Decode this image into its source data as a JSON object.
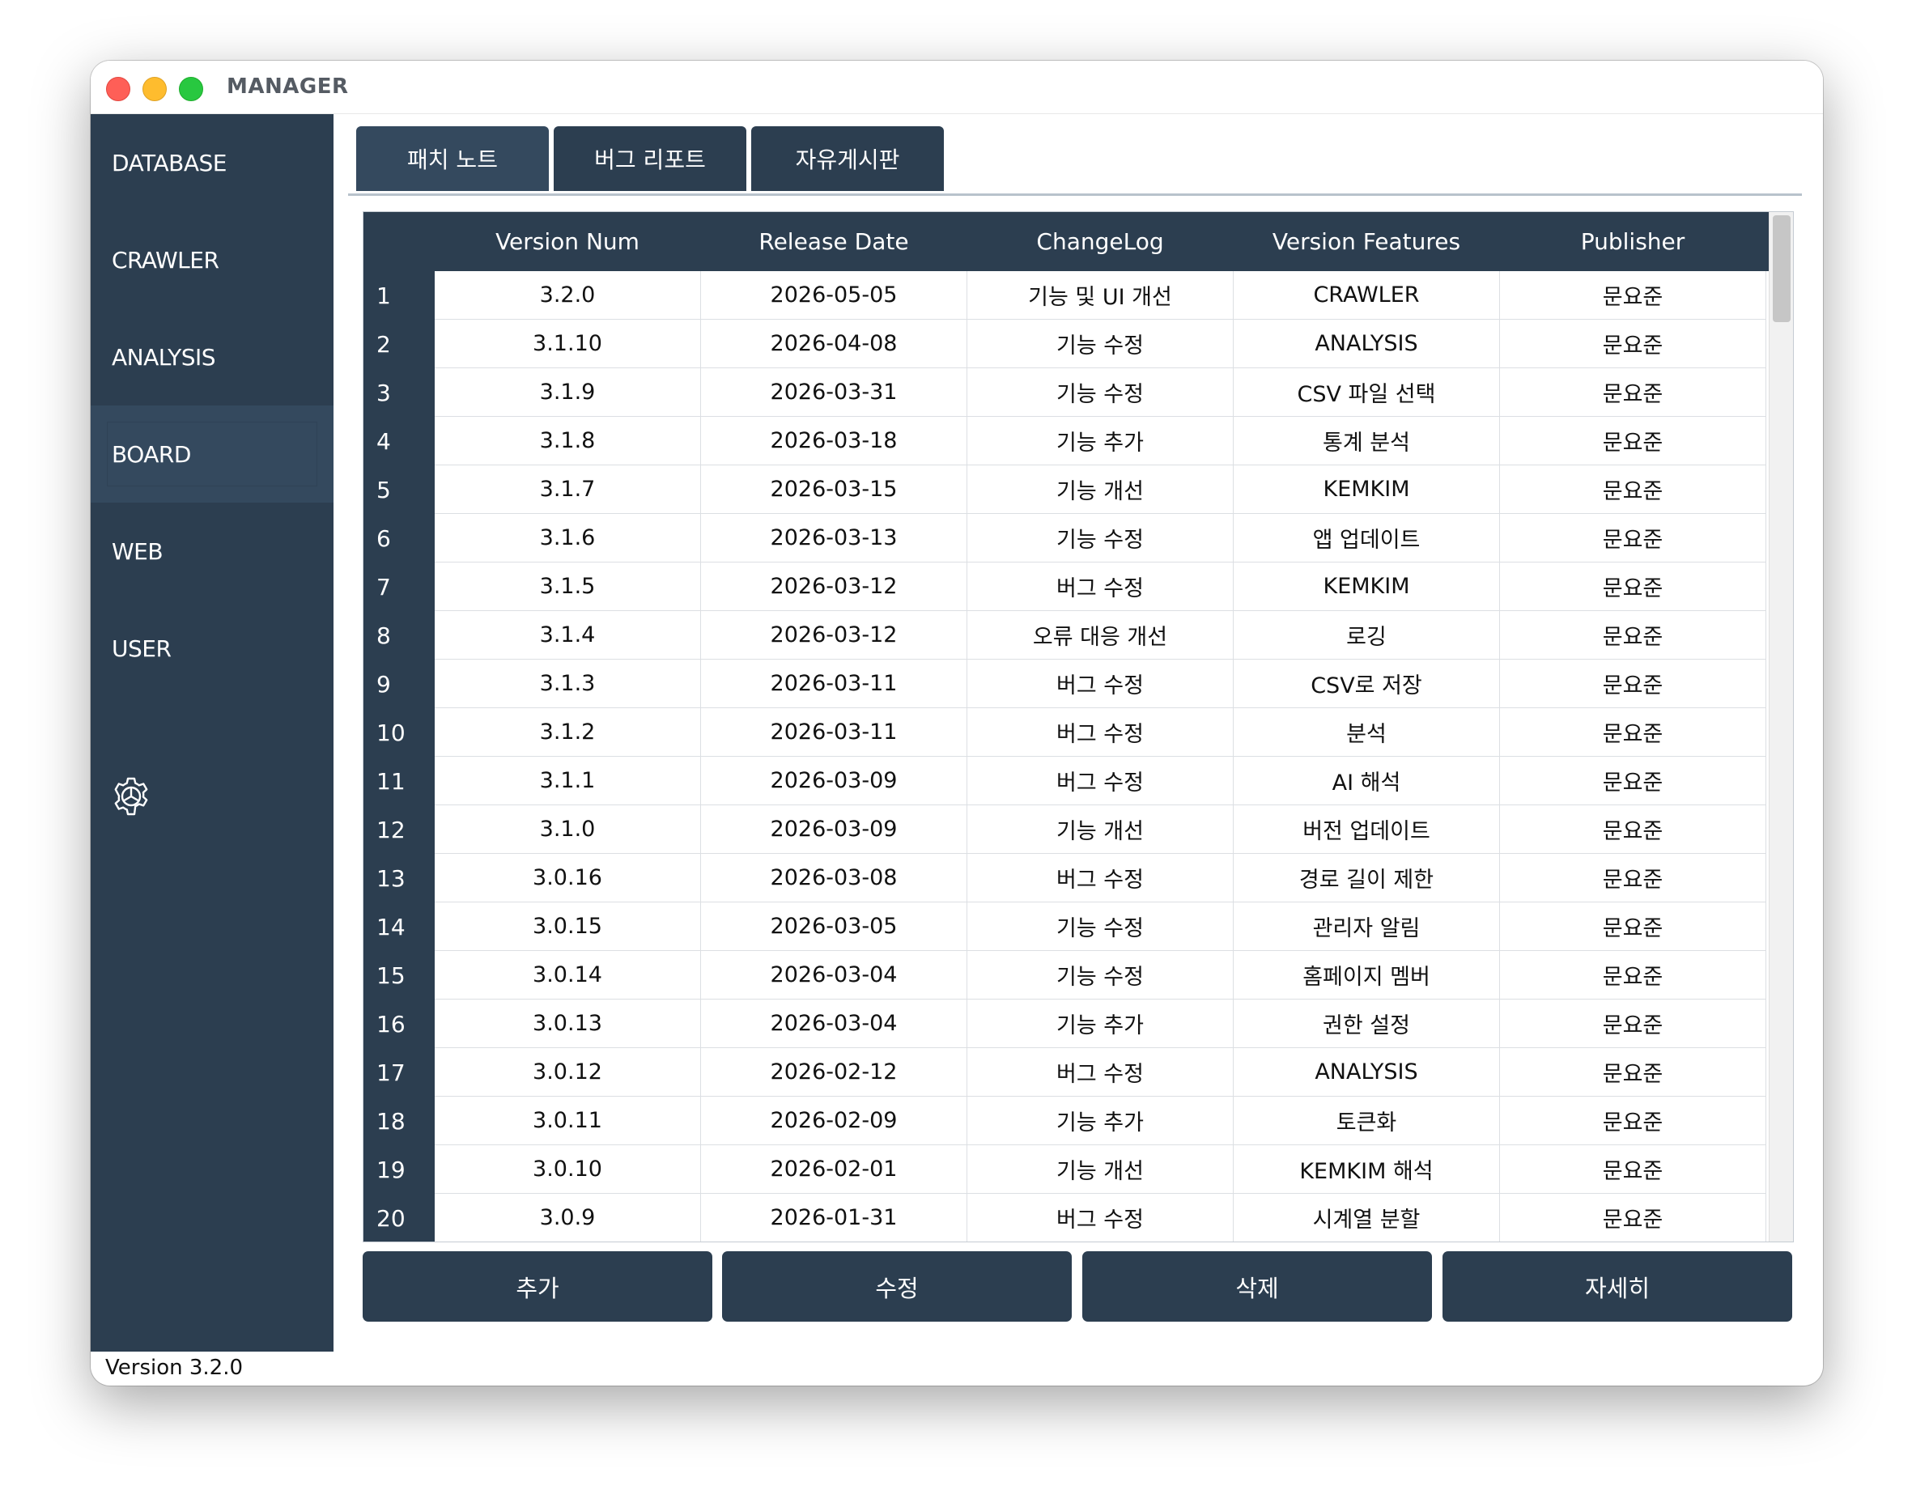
{
  "window": {
    "title": "MANAGER"
  },
  "sidebar": {
    "items": [
      {
        "label": "DATABASE"
      },
      {
        "label": "CRAWLER"
      },
      {
        "label": "ANALYSIS"
      },
      {
        "label": "BOARD",
        "active": true
      },
      {
        "label": "WEB"
      },
      {
        "label": "USER"
      }
    ],
    "settings_icon": "gear-icon",
    "version": "Version 3.2.0"
  },
  "tabs": [
    {
      "label": "패치 노트",
      "active": true
    },
    {
      "label": "버그 리포트"
    },
    {
      "label": "자유게시판"
    }
  ],
  "table": {
    "columns": [
      "Version Num",
      "Release Date",
      "ChangeLog",
      "Version Features",
      "Publisher"
    ],
    "rows": [
      {
        "n": "1",
        "cells": [
          "3.2.0",
          "2026-05-05",
          "기능 및 UI 개선",
          "CRAWLER",
          "문요준"
        ]
      },
      {
        "n": "2",
        "cells": [
          "3.1.10",
          "2026-04-08",
          "기능 수정",
          "ANALYSIS",
          "문요준"
        ]
      },
      {
        "n": "3",
        "cells": [
          "3.1.9",
          "2026-03-31",
          "기능 수정",
          "CSV 파일 선택",
          "문요준"
        ]
      },
      {
        "n": "4",
        "cells": [
          "3.1.8",
          "2026-03-18",
          "기능 추가",
          "통계 분석",
          "문요준"
        ]
      },
      {
        "n": "5",
        "cells": [
          "3.1.7",
          "2026-03-15",
          "기능 개선",
          "KEMKIM",
          "문요준"
        ]
      },
      {
        "n": "6",
        "cells": [
          "3.1.6",
          "2026-03-13",
          "기능 수정",
          "앱 업데이트",
          "문요준"
        ]
      },
      {
        "n": "7",
        "cells": [
          "3.1.5",
          "2026-03-12",
          "버그 수정",
          "KEMKIM",
          "문요준"
        ]
      },
      {
        "n": "8",
        "cells": [
          "3.1.4",
          "2026-03-12",
          "오류 대응 개선",
          "로깅",
          "문요준"
        ]
      },
      {
        "n": "9",
        "cells": [
          "3.1.3",
          "2026-03-11",
          "버그 수정",
          "CSV로 저장",
          "문요준"
        ]
      },
      {
        "n": "10",
        "cells": [
          "3.1.2",
          "2026-03-11",
          "버그 수정",
          "분석",
          "문요준"
        ]
      },
      {
        "n": "11",
        "cells": [
          "3.1.1",
          "2026-03-09",
          "버그 수정",
          "AI 해석",
          "문요준"
        ]
      },
      {
        "n": "12",
        "cells": [
          "3.1.0",
          "2026-03-09",
          "기능 개선",
          "버전 업데이트",
          "문요준"
        ]
      },
      {
        "n": "13",
        "cells": [
          "3.0.16",
          "2026-03-08",
          "버그 수정",
          "경로 길이 제한",
          "문요준"
        ]
      },
      {
        "n": "14",
        "cells": [
          "3.0.15",
          "2026-03-05",
          "기능 수정",
          "관리자 알림",
          "문요준"
        ]
      },
      {
        "n": "15",
        "cells": [
          "3.0.14",
          "2026-03-04",
          "기능 수정",
          "홈페이지 멤버",
          "문요준"
        ]
      },
      {
        "n": "16",
        "cells": [
          "3.0.13",
          "2026-03-04",
          "기능 추가",
          "권한 설정",
          "문요준"
        ]
      },
      {
        "n": "17",
        "cells": [
          "3.0.12",
          "2026-02-12",
          "버그 수정",
          "ANALYSIS",
          "문요준"
        ]
      },
      {
        "n": "18",
        "cells": [
          "3.0.11",
          "2026-02-09",
          "기능 추가",
          "토큰화",
          "문요준"
        ]
      },
      {
        "n": "19",
        "cells": [
          "3.0.10",
          "2026-02-01",
          "기능 개선",
          "KEMKIM 해석",
          "문요준"
        ]
      },
      {
        "n": "20",
        "cells": [
          "3.0.9",
          "2026-01-31",
          "버그 수정",
          "시계열 분할",
          "문요준"
        ]
      }
    ]
  },
  "actions": [
    {
      "label": "추가"
    },
    {
      "label": "수정"
    },
    {
      "label": "삭제"
    },
    {
      "label": "자세히"
    }
  ]
}
